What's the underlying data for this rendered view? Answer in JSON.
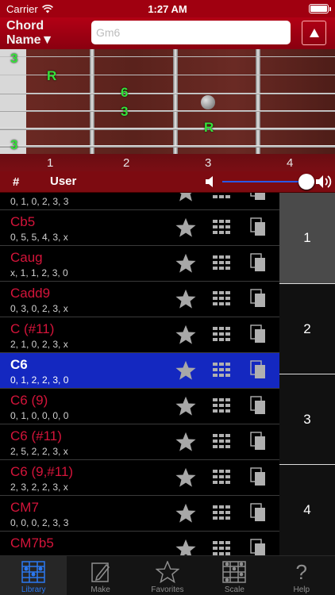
{
  "status": {
    "carrier": "Carrier",
    "time": "1:27 AM"
  },
  "header": {
    "chord_name_label": "Chord Name▼",
    "input_placeholder": "Gm6"
  },
  "fretboard": {
    "marks": [
      {
        "text": "3"
      },
      {
        "text": "R"
      },
      {
        "text": "6"
      },
      {
        "text": "3"
      },
      {
        "text": "R"
      },
      {
        "text": "3"
      }
    ],
    "fret_numbers": [
      "1",
      "2",
      "3",
      "4"
    ]
  },
  "controls": {
    "hash": "#",
    "user": "User",
    "volume_level": 1.0
  },
  "list": {
    "rows": [
      {
        "name": "",
        "fingering": "0, 1, 0, 2, 3, 3",
        "selected": false
      },
      {
        "name": "Cb5",
        "fingering": "0, 5, 5, 4, 3, x",
        "selected": false
      },
      {
        "name": "Caug",
        "fingering": "x, 1, 1, 2, 3, 0",
        "selected": false
      },
      {
        "name": "Cadd9",
        "fingering": "0, 3, 0, 2, 3, x",
        "selected": false
      },
      {
        "name": "C (#11)",
        "fingering": "2, 1, 0, 2, 3, x",
        "selected": false
      },
      {
        "name": "C6",
        "fingering": "0, 1, 2, 2, 3, 0",
        "selected": true
      },
      {
        "name": "C6 (9)",
        "fingering": "0, 1, 0, 0, 0, 0",
        "selected": false
      },
      {
        "name": "C6 (#11)",
        "fingering": "2, 5, 2, 2, 3, x",
        "selected": false
      },
      {
        "name": "C6 (9,#11)",
        "fingering": "2, 3, 2, 2, 3, x",
        "selected": false
      },
      {
        "name": "CM7",
        "fingering": "0, 0, 0, 2, 3, 3",
        "selected": false
      },
      {
        "name": "CM7b5",
        "fingering": "",
        "selected": false
      }
    ]
  },
  "side_index": [
    "1",
    "2",
    "3",
    "4"
  ],
  "tabs": [
    {
      "label": "Library",
      "icon": "library-icon",
      "active": true
    },
    {
      "label": "Make",
      "icon": "make-icon",
      "active": false
    },
    {
      "label": "Favorites",
      "icon": "favorites-icon",
      "active": false
    },
    {
      "label": "Scale",
      "icon": "scale-icon",
      "active": false
    },
    {
      "label": "Help",
      "icon": "help-icon",
      "active": false
    }
  ],
  "colors": {
    "accent_red": "#a00010",
    "chord_red": "#d4143a",
    "selected_blue": "#1428c0",
    "note_green": "#35e23a",
    "tab_active": "#2b78f0"
  }
}
